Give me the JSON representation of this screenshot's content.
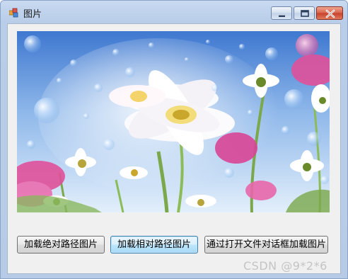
{
  "window": {
    "title": "图片",
    "controls": {
      "minimize_icon": "minimize-icon",
      "maximize_icon": "maximize-icon",
      "close_icon": "close-icon"
    }
  },
  "picture": {
    "description_icon": "flower-image",
    "colors": {
      "sky_top": "#4f86d6",
      "sky_bottom": "#cfe3f7",
      "petal": "#ffffff",
      "pink": "#e0509a",
      "leaf": "#6aa84f"
    }
  },
  "buttons": {
    "load_absolute": "加载绝对路径图片",
    "load_relative": "加载相对路径图片",
    "load_dialog": "通过打开文件对话框加载图片"
  },
  "watermark": "CSDN @9*2*6"
}
